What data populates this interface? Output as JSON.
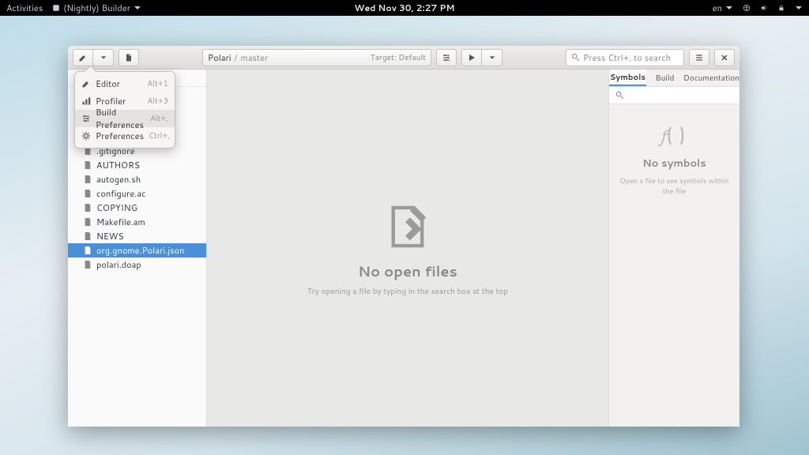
{
  "topbar": {
    "activities": "Activities",
    "app": "(Nightly) Builder",
    "datetime": "Wed Nov 30,  2:27 PM",
    "lang": "en"
  },
  "header": {
    "project": "Polari",
    "branch": "master",
    "target_label": "Target: Default",
    "search_placeholder": "Press Ctrl+. to search"
  },
  "popover": {
    "items": [
      {
        "label": "Editor",
        "shortcut": "Alt+1",
        "icon": "pencil"
      },
      {
        "label": "Profiler",
        "shortcut": "Alt+3",
        "icon": "profiler"
      },
      {
        "label": "Build Preferences",
        "shortcut": "Alt+,",
        "icon": "build-prefs",
        "hover": true
      },
      {
        "label": "Preferences",
        "shortcut": "Ctrl+,",
        "icon": "prefs"
      }
    ]
  },
  "files": [
    {
      "name": ".gitignore"
    },
    {
      "name": "AUTHORS"
    },
    {
      "name": "autogen.sh"
    },
    {
      "name": "configure.ac"
    },
    {
      "name": "COPYING"
    },
    {
      "name": "Makefile.am"
    },
    {
      "name": "NEWS"
    },
    {
      "name": "org.gnome.Polari.json",
      "selected": true
    },
    {
      "name": "polari.doap"
    }
  ],
  "editor": {
    "title": "No open files",
    "hint": "Try opening a file by typing in the search box at the top"
  },
  "sympanel": {
    "tabs": [
      "Symbols",
      "Build",
      "Documentation"
    ],
    "active_tab": 0,
    "title": "No symbols",
    "hint": "Open a file to see symbols within the file"
  }
}
